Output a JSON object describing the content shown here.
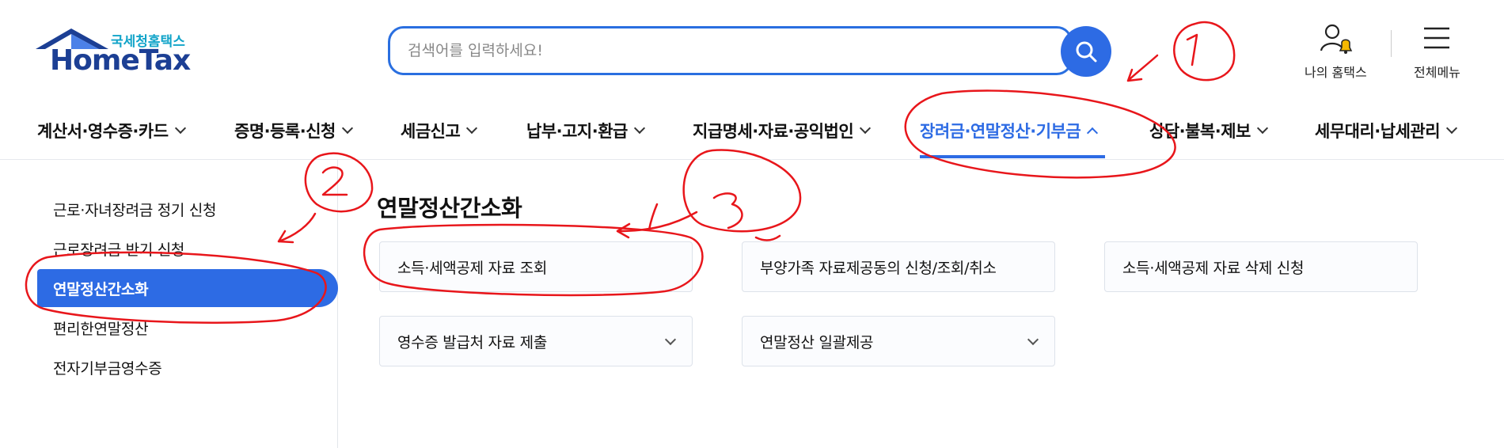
{
  "header": {
    "logo_sub": "국세청홈택스",
    "logo_main": "HomeTax",
    "search_placeholder": "검색어를 입력하세요!",
    "my_hometax_label": "나의 홈택스",
    "all_menu_label": "전체메뉴"
  },
  "gnb": {
    "items": [
      {
        "label": "계산서·영수증·카드"
      },
      {
        "label": "증명·등록·신청"
      },
      {
        "label": "세금신고"
      },
      {
        "label": "납부·고지·환급"
      },
      {
        "label": "지급명세·자료·공익법인"
      },
      {
        "label": "장려금·연말정산·기부금",
        "active": true
      },
      {
        "label": "상담·불복·제보"
      },
      {
        "label": "세무대리·납세관리"
      }
    ]
  },
  "sidebar": {
    "items": [
      {
        "label": "근로·자녀장려금 정기 신청"
      },
      {
        "label": "근로장려금 반기 신청"
      },
      {
        "label": "연말정산간소화",
        "active": true
      },
      {
        "label": "편리한연말정산"
      },
      {
        "label": "전자기부금영수증"
      }
    ]
  },
  "main": {
    "title": "연말정산간소화",
    "cards": [
      {
        "label": "소득·세액공제 자료 조회"
      },
      {
        "label": "부양가족 자료제공동의 신청/조회/취소"
      },
      {
        "label": "소득·세액공제 자료 삭제 신청"
      },
      {
        "label": "영수증 발급처 자료 제출",
        "has_dropdown": true
      },
      {
        "label": "연말정산 일괄제공",
        "has_dropdown": true
      }
    ]
  },
  "annotations": {
    "color": "#e8161b",
    "marks": [
      "1",
      "2",
      "3"
    ]
  },
  "colors": {
    "accent": "#2d6be4",
    "logo_blue": "#1c3f94",
    "logo_sub": "#12a4c9",
    "bell": "#f5b800"
  }
}
